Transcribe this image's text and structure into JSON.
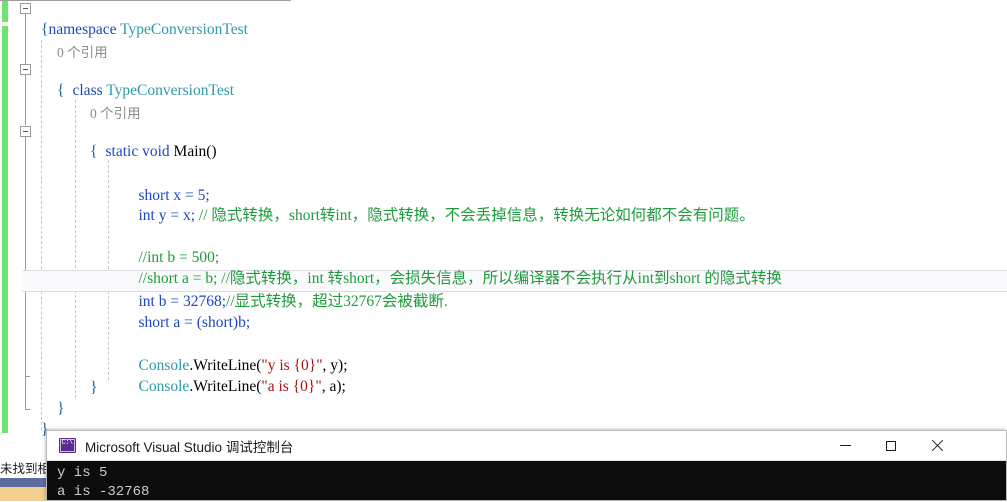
{
  "editor": {
    "codelens_label": "0 个引用",
    "lines": [
      {
        "id": "l1",
        "indent": 0,
        "text": "namespace TypeConversionTest"
      },
      {
        "id": "l2",
        "indent": 1,
        "text": "{"
      },
      {
        "id": "l3",
        "indent": 2,
        "text": "class TypeConversionTest"
      },
      {
        "id": "l4",
        "indent": 2,
        "text": "{"
      },
      {
        "id": "l5",
        "indent": 3,
        "text": "static void Main()"
      },
      {
        "id": "l6",
        "indent": 3,
        "text": "{"
      },
      {
        "id": "l7",
        "indent": 4,
        "text": "short x = 5;"
      },
      {
        "id": "l8",
        "indent": 4,
        "text": "int y = x; // 隐式转换，short转int，隐式转换，不会丢掉信息，转换无论如何都不会有问题。"
      },
      {
        "id": "l9",
        "indent": 4,
        "text": ""
      },
      {
        "id": "l10",
        "indent": 4,
        "text": "//int b = 500;"
      },
      {
        "id": "l11",
        "indent": 4,
        "text": "//short a = b; //隐式转换，int 转short，会损失信息，所以编译器不会执行从int到short 的隐式转换"
      },
      {
        "id": "l12",
        "indent": 4,
        "text": "int b = 32768;//显式转换，超过32767会被截断."
      },
      {
        "id": "l13",
        "indent": 4,
        "text": "short a = (short)b;"
      },
      {
        "id": "l14",
        "indent": 4,
        "text": ""
      },
      {
        "id": "l15",
        "indent": 4,
        "text": "Console.WriteLine(\"y is {0}\", y);"
      },
      {
        "id": "l16",
        "indent": 4,
        "text": "Console.WriteLine(\"a is {0}\", a);"
      },
      {
        "id": "l17",
        "indent": 3,
        "text": "}"
      },
      {
        "id": "l18",
        "indent": 2,
        "text": "}"
      },
      {
        "id": "l19",
        "indent": 1,
        "text": "}"
      }
    ],
    "tokens": {
      "kw_namespace": "namespace",
      "kw_class": "class",
      "kw_static": "static",
      "kw_void": "void",
      "kw_short": "short",
      "kw_int": "int",
      "type_name": "TypeConversionTest",
      "method_main": "Main()",
      "class_console": "Console",
      "method_writeline": ".WriteLine(",
      "str_y": "\"y is {0}\"",
      "str_a": "\"a is {0}\"",
      "comment_1": "// 隐式转换，short转int，隐式转换，不会丢掉信息，转换无论如何都不会有问题。",
      "comment_2": "//int b = 500;",
      "comment_3": "//short a = b; //隐式转换，int 转short，会损失信息，所以编译器不会执行从int到short 的隐式转换",
      "comment_4": "//显式转换，超过32767会被截断.",
      "stmt_short_x": "short x = 5;",
      "stmt_int_y": "int y = x; ",
      "stmt_int_b": "int b = 32768;",
      "stmt_short_a": "short a = (short)b;",
      "arg_y": ", y);",
      "arg_a": ", a);"
    },
    "colors": {
      "keyword": "#1d48c0",
      "type": "#2e9aa8",
      "comment": "#1f9b3e",
      "string": "#a31515",
      "change_bar": "#6ee46e",
      "current_line_border": "#dcdce6"
    }
  },
  "status_bar": {
    "message": "未找到相"
  },
  "console_window": {
    "icon": "console-app-icon",
    "title": "Microsoft Visual Studio 调试控制台",
    "buttons": {
      "minimize": "minimize-button",
      "maximize": "maximize-button",
      "close": "close-button"
    },
    "output": [
      "y is 5",
      "a is -32768"
    ]
  }
}
